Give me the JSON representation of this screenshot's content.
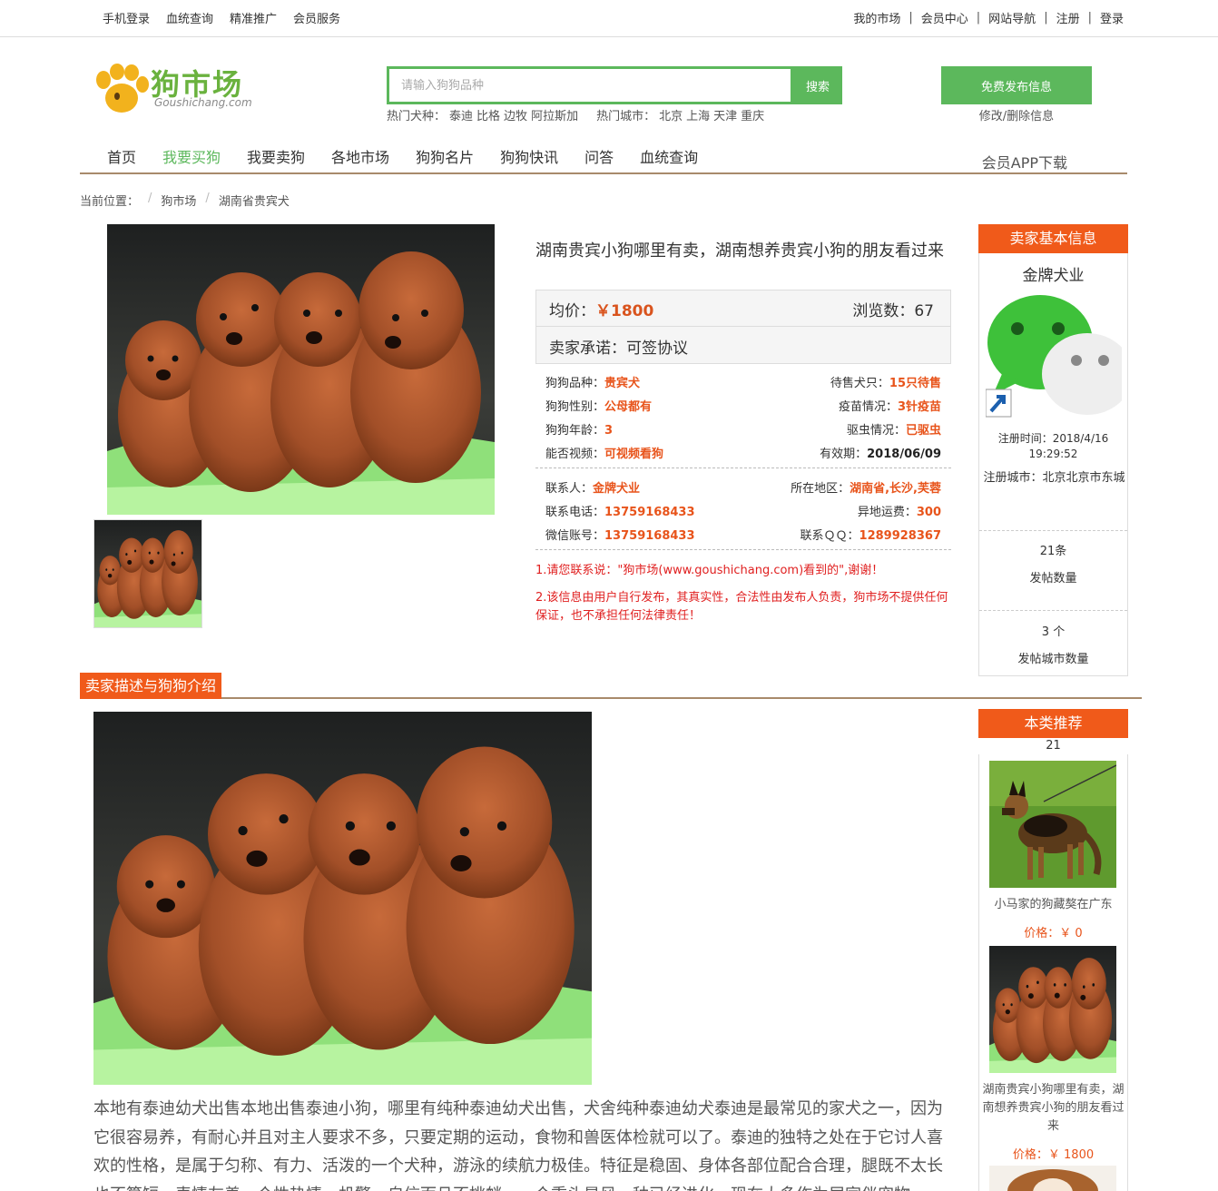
{
  "topbar": {
    "left": [
      "手机登录",
      "血统查询",
      "精准推广",
      "会员服务"
    ],
    "right": [
      "我的市场",
      "会员中心",
      "网站导航",
      "注册",
      "登录"
    ]
  },
  "logo": {
    "cn": "狗市场",
    "en": "Goushichang.com"
  },
  "search": {
    "placeholder": "请输入狗狗品种",
    "button": "搜索",
    "hot_breeds_label": "热门犬种：",
    "hot_breeds": [
      "泰迪",
      "比格",
      "边牧",
      "阿拉斯加"
    ],
    "hot_cities_label": "热门城市：",
    "hot_cities": [
      "北京",
      "上海",
      "天津",
      "重庆"
    ]
  },
  "publish": {
    "button": "免费发布信息",
    "modify": "修改/删除信息"
  },
  "nav": {
    "items": [
      "首页",
      "我要买狗",
      "我要卖狗",
      "各地市场",
      "狗狗名片",
      "狗狗快讯",
      "问答",
      "血统查询"
    ],
    "active": "我要买狗",
    "app": "会员APP下载"
  },
  "breadcrumb": {
    "label": "当前位置：",
    "items": [
      "狗市场",
      "湖南省贵宾犬"
    ]
  },
  "listing": {
    "title": "湖南贵宾小狗哪里有卖，湖南想养贵宾小狗的朋友看过来",
    "avg_price_label": "均价：",
    "avg_price": "￥1800",
    "views_label": "浏览数：",
    "views": "67",
    "promise_label": "卖家承诺：",
    "promise": "可签协议",
    "specs": [
      {
        "l_label": "狗狗品种：",
        "l_value": "贵宾犬",
        "r_label": "待售犬只：",
        "r_value": "15只待售"
      },
      {
        "l_label": "狗狗性别：",
        "l_value": "公母都有",
        "r_label": "疫苗情况：",
        "r_value": "3针疫苗"
      },
      {
        "l_label": "狗狗年龄：",
        "l_value": "3",
        "r_label": "驱虫情况：",
        "r_value": "已驱虫"
      },
      {
        "l_label": "能否视频：",
        "l_value": "可视频看狗",
        "r_label": "有效期：",
        "r_value": "2018/06/09"
      }
    ],
    "contacts": [
      {
        "l_label": "联系人：",
        "l_value": "金牌犬业",
        "r_label": "所在地区：",
        "r_value": "湖南省,长沙,芙蓉"
      },
      {
        "l_label": "联系电话：",
        "l_value": "13759168433",
        "r_label": "异地运费：",
        "r_value": "300"
      },
      {
        "l_label": "微信账号：",
        "l_value": "13759168433",
        "r_label": "联系ＱＱ：",
        "r_value": "1289928367"
      }
    ],
    "notice1": "1.请您联系说：\"狗市场(www.goushichang.com)看到的\",谢谢！",
    "notice2": "2.该信息由用户自行发布，其真实性，合法性由发布人负责，狗市场不提供任何保证，也不承担任何法律责任！"
  },
  "seller": {
    "header": "卖家基本信息",
    "name": "金牌犬业",
    "reg_time": "注册时间：2018/4/16 19:29:52",
    "reg_city": "注册城市：北京北京市东城",
    "posts": "21条",
    "posts_label": "发帖数量",
    "cities": "3 个",
    "cities_label": "发帖城市数量"
  },
  "description": {
    "header": "卖家描述与狗狗介绍",
    "text": "本地有泰迪幼犬出售本地出售泰迪小狗，哪里有纯种泰迪幼犬出售，犬舍纯种泰迪幼犬泰迪是最常见的家犬之一，因为它很容易养，有耐心并且对主人要求不多，只要定期的运动，食物和兽医体检就可以了。泰迪的独特之处在于它讨人喜欢的性格，是属于匀称、有力、活泼的一个犬种，游泳的续航力极佳。特征是稳固、身体各部位配合合理，腿既不太长也不算短，表情友善，个性热情，机警，自信而且不挑衅。一个重头是风，种已经进化，现在大多作为居家伴宠物"
  },
  "recommend": {
    "header": "本类推荐",
    "count": "21",
    "items": [
      {
        "title": "小马家的狗藏獒在广东",
        "price_label": "价格：",
        "price": "￥ 0"
      },
      {
        "title": "湖南贵宾小狗哪里有卖，湖南想养贵宾小狗的朋友看过来",
        "price_label": "价格：",
        "price": "￥ 1800"
      }
    ]
  },
  "colors": {
    "green": "#5cb85c",
    "orange": "#f05a1a",
    "price": "#e8541b",
    "red_notice": "#e02020",
    "brown_rule": "#a88a6b"
  }
}
